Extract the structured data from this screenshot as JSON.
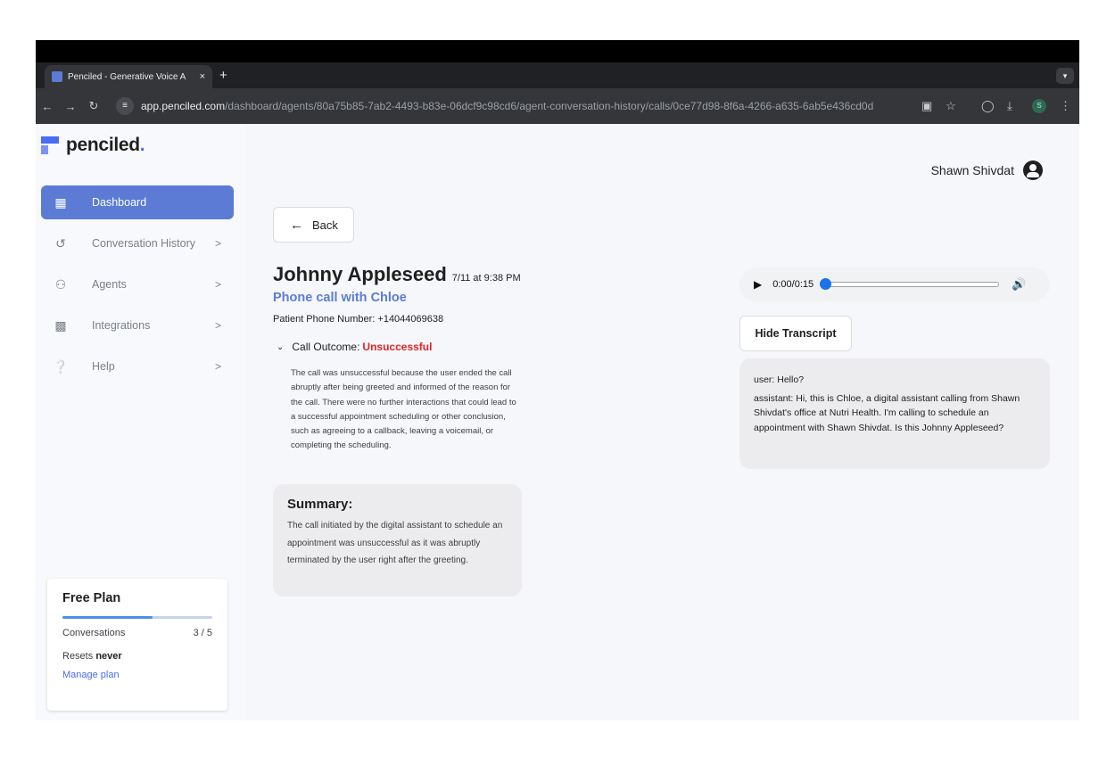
{
  "browser": {
    "tab_title": "Penciled - Generative Voice A",
    "tab_close": "×",
    "new_tab": "+",
    "url_host": "app.penciled.com",
    "url_path": "/dashboard/agents/80a75b85-7ab2-4493-b83e-06dcf9c98cd6/agent-conversation-history/calls/0ce77d98-8f6a-4266-a635-6ab5e436cd0d",
    "profile_initial": "S"
  },
  "brand": {
    "name": "penciled",
    "dot": ".",
    "accent": "#4a6cf7"
  },
  "sidebar": {
    "items": [
      {
        "label": "Dashboard",
        "icon": "dashboard-icon",
        "active": true
      },
      {
        "label": "Conversation History",
        "icon": "history-icon",
        "chevron": ">"
      },
      {
        "label": "Agents",
        "icon": "people-icon",
        "chevron": ">"
      },
      {
        "label": "Integrations",
        "icon": "integrations-icon",
        "chevron": ">"
      },
      {
        "label": "Help",
        "icon": "help-icon",
        "chevron": ">"
      }
    ]
  },
  "plan": {
    "title": "Free Plan",
    "conversations_label": "Conversations",
    "conversations_value": "3 / 5",
    "usage_fraction": 0.6,
    "resets_label": "Resets",
    "resets_value": "never",
    "manage_link": "Manage plan"
  },
  "user": {
    "name": "Shawn Shivdat"
  },
  "call": {
    "back_label": "Back",
    "patient_name": "Johnny Appleseed",
    "time": "7/11 at 9:38 PM",
    "subtitle": "Phone call with Chloe",
    "phone_line": "Patient Phone Number: +14044069638",
    "outcome_label": "Call Outcome:",
    "outcome_value": "Unsuccessful",
    "outcome_text": "The call was unsuccessful because the user ended the call abruptly after being greeted and informed of the reason for the call. There were no further interactions that could lead to a successful appointment scheduling or other conclusion, such as agreeing to a callback, leaving a voicemail, or completing the scheduling.",
    "summary_title": "Summary:",
    "summary_text": "The call initiated by the digital assistant to schedule an appointment was unsuccessful as it was abruptly terminated by the user right after the greeting."
  },
  "player": {
    "time": "0:00/0:15",
    "progress": 0.0
  },
  "transcript": {
    "button_label": "Hide Transcript",
    "lines": [
      "user: Hello?",
      "assistant: Hi, this is Chloe, a digital assistant calling from Shawn Shivdat's office at Nutri Health. I'm calling to schedule an appointment with Shawn Shivdat. Is this Johnny Appleseed?"
    ]
  }
}
